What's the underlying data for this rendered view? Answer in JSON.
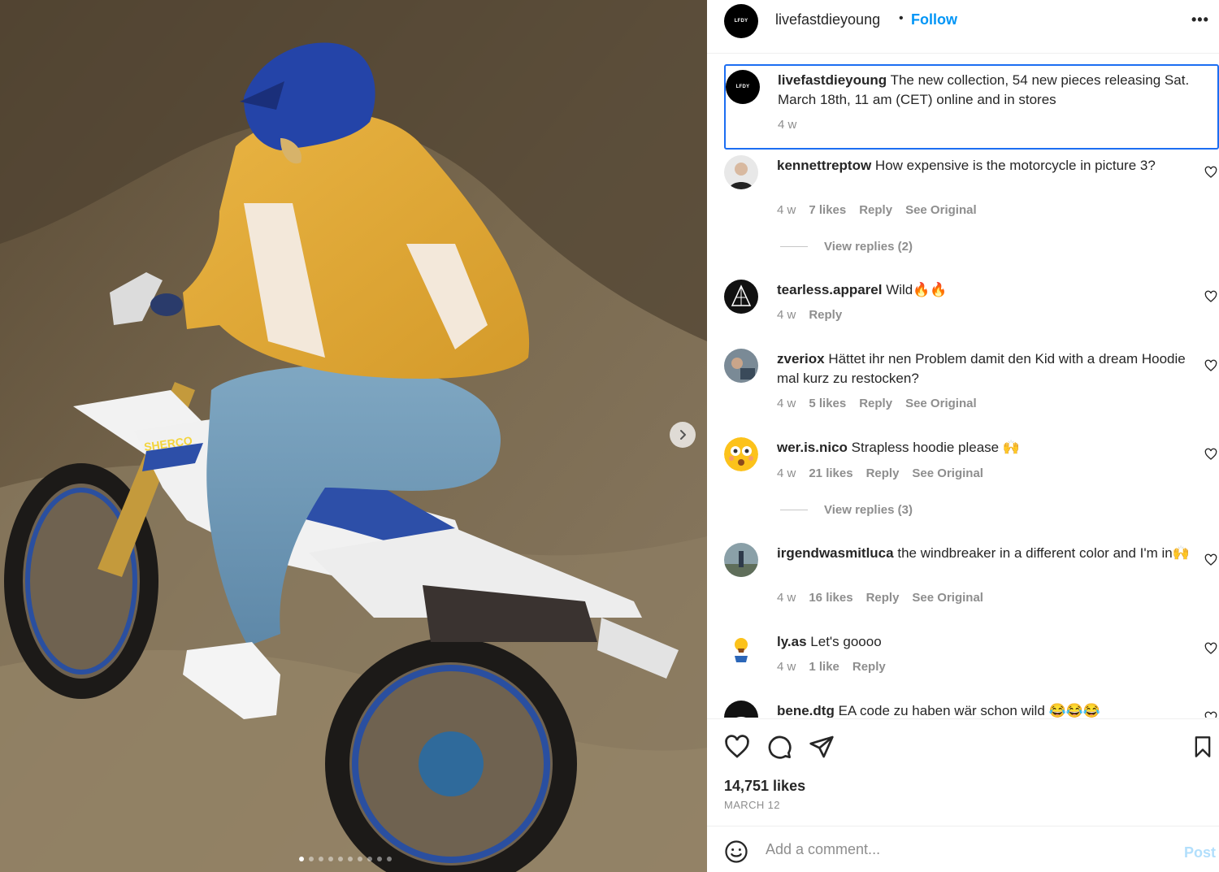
{
  "post": {
    "photo_alt": "",
    "carousel_dots": 10,
    "carousel_active": 0,
    "icons": {
      "next": "chevron-right-icon"
    }
  },
  "header": {
    "avatar_text": "LFDY",
    "username": "livefastdieyoung",
    "separator": "•",
    "follow_label": "Follow",
    "more_label": "•••"
  },
  "caption": {
    "avatar_text": "LFDY",
    "username": "livefastdieyoung",
    "text": "The new collection, 54 new pieces releasing Sat. March 18th, 11 am (CET) online and in stores",
    "time": "4 w"
  },
  "comments": [
    {
      "username": "kennettreptow",
      "text": "How expensive is the motorcycle in picture 3?",
      "time": "4 w",
      "likes": "7 likes",
      "reply": "Reply",
      "see_original": "See Original",
      "view_replies": "View replies (2)"
    },
    {
      "username": "tearless.apparel",
      "text": "Wild🔥🔥",
      "time": "4 w",
      "likes": "",
      "reply": "Reply",
      "see_original": "",
      "view_replies": ""
    },
    {
      "username": "zveriox",
      "text": "Hättet ihr nen Problem damit den Kid with a dream Hoodie mal kurz zu restocken?",
      "time": "4 w",
      "likes": "5 likes",
      "reply": "Reply",
      "see_original": "See Original",
      "view_replies": ""
    },
    {
      "username": "wer.is.nico",
      "text": "Strapless hoodie please 🙌",
      "time": "4 w",
      "likes": "21 likes",
      "reply": "Reply",
      "see_original": "See Original",
      "view_replies": "View replies (3)"
    },
    {
      "username": "irgendwasmitluca",
      "text": "the windbreaker in a different color and I'm in🙌",
      "time": "4 w",
      "likes": "16 likes",
      "reply": "Reply",
      "see_original": "See Original",
      "view_replies": ""
    },
    {
      "username": "ly.as",
      "text": "Let's goooo",
      "time": "4 w",
      "likes": "1 like",
      "reply": "Reply",
      "see_original": "",
      "view_replies": ""
    },
    {
      "username": "bene.dtg",
      "text": "EA code zu haben wär schon wild 😂😂😂",
      "time": "",
      "likes": "",
      "reply": "",
      "see_original": "",
      "view_replies": ""
    }
  ],
  "actions": {
    "icons": [
      "heart-icon",
      "comment-icon",
      "share-icon",
      "bookmark-icon"
    ],
    "likes": "14,751 likes",
    "date": "MARCH 12"
  },
  "add_comment": {
    "placeholder": "Add a comment...",
    "post_label": "Post",
    "icon": "emoji-icon"
  },
  "colors": {
    "link_blue": "#0095f6",
    "caption_focus_border": "#1c6ef2",
    "muted_text": "#8e8e8e",
    "post_disabled": "#b2dffc"
  }
}
